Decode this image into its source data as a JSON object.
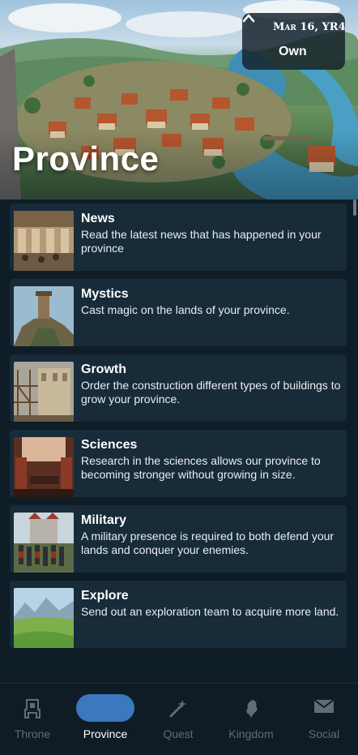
{
  "hero": {
    "title": "Province",
    "date": "Mar 16, YR4",
    "own_label": "Own"
  },
  "sections": [
    {
      "title": "News",
      "description": "Read the latest news that has happened in your province",
      "icon": "news-thumbnail"
    },
    {
      "title": "Mystics",
      "description": "Cast magic on the lands of your province.",
      "icon": "mystics-thumbnail"
    },
    {
      "title": "Growth",
      "description": "Order the construction different types of buildings to grow your province.",
      "icon": "growth-thumbnail"
    },
    {
      "title": "Sciences",
      "description": "Research in the sciences allows our province to becoming stronger without growing in size.",
      "icon": "sciences-thumbnail"
    },
    {
      "title": "Military",
      "description": "A military presence is required to both defend your lands and conquer your enemies.",
      "icon": "military-thumbnail"
    },
    {
      "title": "Explore",
      "description": "Send out an exploration team to acquire more land.",
      "icon": "explore-thumbnail"
    }
  ],
  "nav": [
    {
      "label": "Throne",
      "icon": "throne-icon",
      "active": false
    },
    {
      "label": "Province",
      "icon": "province-icon",
      "active": true
    },
    {
      "label": "Quest",
      "icon": "quest-icon",
      "active": false
    },
    {
      "label": "Kingdom",
      "icon": "kingdom-icon",
      "active": false
    },
    {
      "label": "Social",
      "icon": "social-icon",
      "active": false
    }
  ],
  "colors": {
    "background": "#0f1c26",
    "card": "#172b39",
    "accent": "#3a78c0",
    "inactive": "#5f6d78"
  }
}
